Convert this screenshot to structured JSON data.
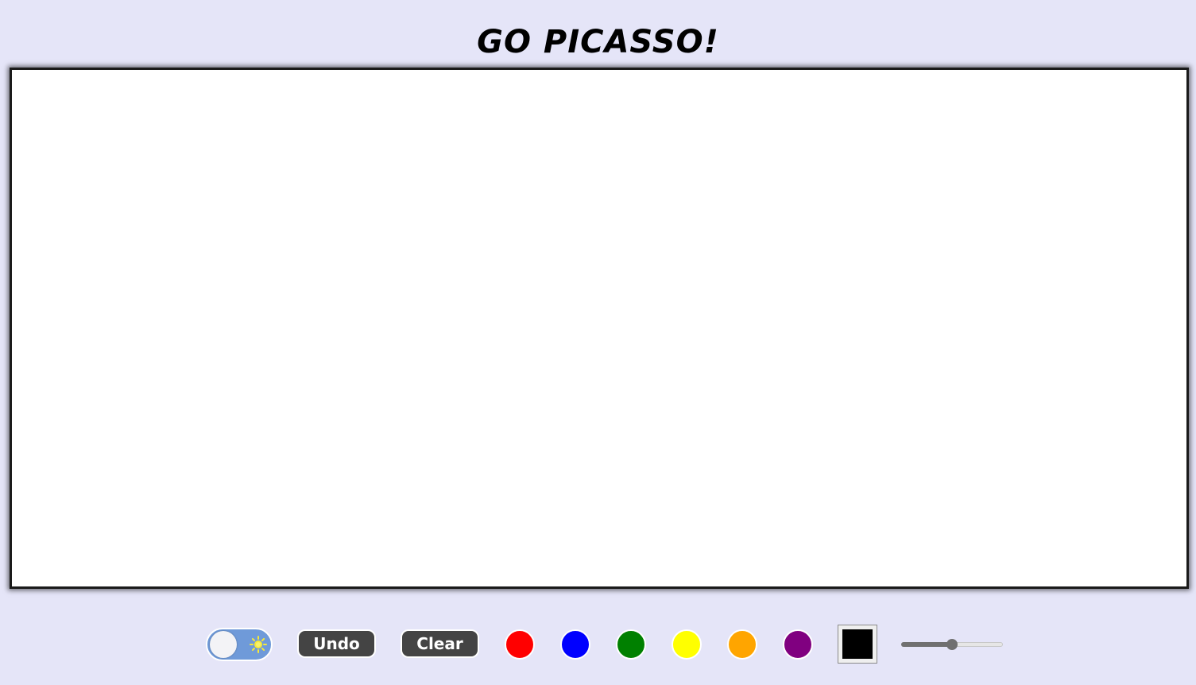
{
  "page": {
    "title": "GO PICASSO!",
    "background_color": "#e5e5f8"
  },
  "canvas": {
    "background_color": "#ffffff"
  },
  "toolbar": {
    "theme_toggle": {
      "state": "light",
      "icon": "sun-icon",
      "track_color": "#6f9ad9",
      "icon_color": "#f5e83a"
    },
    "undo_label": "Undo",
    "clear_label": "Clear",
    "button_color": "#444444",
    "swatches": [
      {
        "name": "red",
        "color": "#ff0000"
      },
      {
        "name": "blue",
        "color": "#0000ff"
      },
      {
        "name": "green",
        "color": "#008000"
      },
      {
        "name": "yellow",
        "color": "#ffff00"
      },
      {
        "name": "orange",
        "color": "#ffa500"
      },
      {
        "name": "purple",
        "color": "#800080"
      }
    ],
    "color_picker": {
      "value": "#000000"
    },
    "brush_size_slider": {
      "fraction": 0.5
    }
  }
}
